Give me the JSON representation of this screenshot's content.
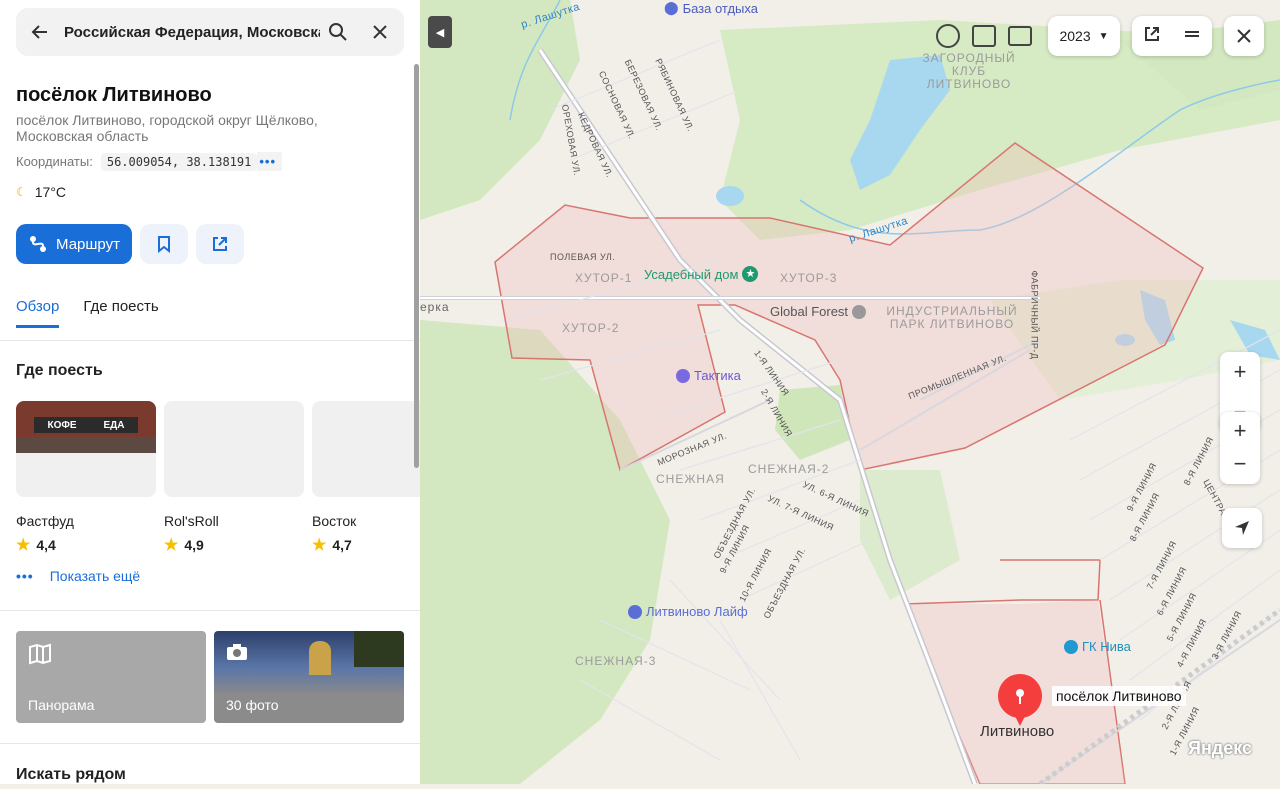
{
  "search": {
    "query": "Российская Федерация, Московская область, городской округ Щёлково, посёлок Литвиново"
  },
  "place": {
    "title": "посёлок Литвиново",
    "subtitle": "посёлок Литвиново, городской округ Щёлково, Московская область",
    "coords_label": "Координаты:",
    "coords_value": "56.009054, 38.138191",
    "coords_more": "•••",
    "weather": "17°C"
  },
  "actions": {
    "route_label": "Маршрут"
  },
  "tabs": [
    {
      "label": "Обзор",
      "active": true
    },
    {
      "label": "Где поесть",
      "active": false
    }
  ],
  "eat": {
    "title": "Где поесть",
    "cards": [
      {
        "name": "Фастфуд",
        "rating": "4,4",
        "sign_left": "КОФЕ",
        "sign_right": "ЕДА"
      },
      {
        "name": "Rol'sRoll",
        "rating": "4,9"
      },
      {
        "name": "Восток",
        "rating": "4,7"
      }
    ],
    "show_more": "Показать ещё"
  },
  "media": {
    "panorama_label": "Панорама",
    "photos_label": "30 фото"
  },
  "nearby_title": "Искать рядом",
  "map": {
    "year": "2023",
    "zoom_in": "+",
    "zoom_out": "−",
    "pin_label": "посёлок Литвиново",
    "town_label": "Литвиново",
    "brand": "Яндекс",
    "pois": {
      "baza": "База отдыха",
      "usadebny": "Усадебный дом",
      "global_forest": "Global Forest",
      "taktika": "Тактика",
      "litvinovo_life": "Литвиново Лайф",
      "gk_niva": "ГК Нива"
    },
    "areas": {
      "club": "ЗАГОРОДНЫЙ КЛУБ ЛИТВИНОВО",
      "hutor1": "ХУТОР-1",
      "hutor2": "ХУТОР-2",
      "hutor3": "ХУТОР-3",
      "park": "ИНДУСТРИАЛЬНЫЙ ПАРК ЛИТВИНОВО",
      "snezhnaya": "СНЕЖНАЯ",
      "snezhnaya2": "СНЕЖНАЯ-2",
      "snezhnaya3": "СНЕЖНАЯ-3",
      "erka": "ерка"
    },
    "rivers": {
      "lashutka1": "р. Лашутка",
      "lashutka2": "р. Лашутка"
    },
    "streets": {
      "polevaya": "ПОЛЕВАЯ УЛ.",
      "orehovaya": "ОРЕХОВАЯ УЛ.",
      "kedrovaya": "КЕДРОВАЯ УЛ.",
      "sosnovaya": "СОСНОВАЯ УЛ.",
      "berezovaya": "БЕРЕЗОВАЯ УЛ.",
      "ryabinovaya": "РЯБИНОВАЯ УЛ.",
      "fabrichny": "ФАБРИЧНЫЙ ПР-Д",
      "promyshlennaya": "ПРОМЫШЛЕННАЯ УЛ.",
      "moroznaya": "МОРОЗНАЯ УЛ.",
      "l1": "1-Я ЛИНИЯ",
      "l2": "2-Я ЛИНИЯ",
      "l6": "УЛ. 6-Я ЛИНИЯ",
      "l7": "УЛ. 7-Я ЛИНИЯ",
      "obezd1": "ОБЪЕЗДНАЯ УЛ.",
      "obezd2": "ОБЪЕЗДНАЯ УЛ.",
      "l9": "9-Я ЛИНИЯ",
      "l10": "10-Я ЛИНИЯ",
      "r9": "9-Я ЛИНИЯ",
      "r8": "8-Я ЛИНИЯ",
      "r7": "7-Я ЛИНИЯ",
      "r6": "6-Я ЛИНИЯ",
      "r5": "5-Я ЛИНИЯ",
      "r4": "4-Я ЛИНИЯ",
      "r3": "3-Я ЛИНИЯ",
      "r2": "2-Я ЛИНИЯ",
      "r1": "1-Я ЛИНИЯ",
      "r8b": "8-Я ЛИНИЯ",
      "central": "ЦЕНТРАЛЬ"
    }
  },
  "colors": {
    "accent": "#1a6ed8",
    "boundary": "#d9756f",
    "water": "#a8d8f0",
    "forest": "#d3e8c0"
  }
}
